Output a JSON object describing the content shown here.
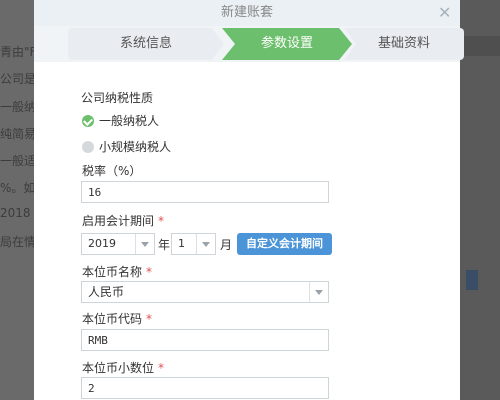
{
  "background": {
    "left_lines": [
      "青由\"F",
      "公司是",
      "一般纳",
      "纯简易",
      "一般适",
      "%。如",
      "2018",
      "局在情"
    ]
  },
  "dialog": {
    "title": "新建账套",
    "steps": [
      "系统信息",
      "参数设置",
      "基础资料"
    ],
    "active_step": 1,
    "taxpayer_label": "公司纳税性质",
    "taxpayer_options": [
      {
        "label": "一般纳税人",
        "selected": true
      },
      {
        "label": "小规模纳税人",
        "selected": false
      }
    ],
    "tax_rate_label": "税率（%）",
    "tax_rate_value": "16",
    "period_label": "启用会计期间",
    "required_mark": "*",
    "year_value": "2019",
    "year_unit": "年",
    "month_value": "1",
    "month_unit": "月",
    "custom_period_button": "自定义会计期间",
    "currency_name_label": "本位币名称",
    "currency_name_value": "人民币",
    "currency_code_label": "本位币代码",
    "currency_code_value": "RMB",
    "currency_decimals_label": "本位币小数位",
    "currency_decimals_value": "2"
  },
  "colors": {
    "accent_green": "#6cbf6c",
    "button_blue": "#4b94d8",
    "required_red": "#e05050"
  }
}
